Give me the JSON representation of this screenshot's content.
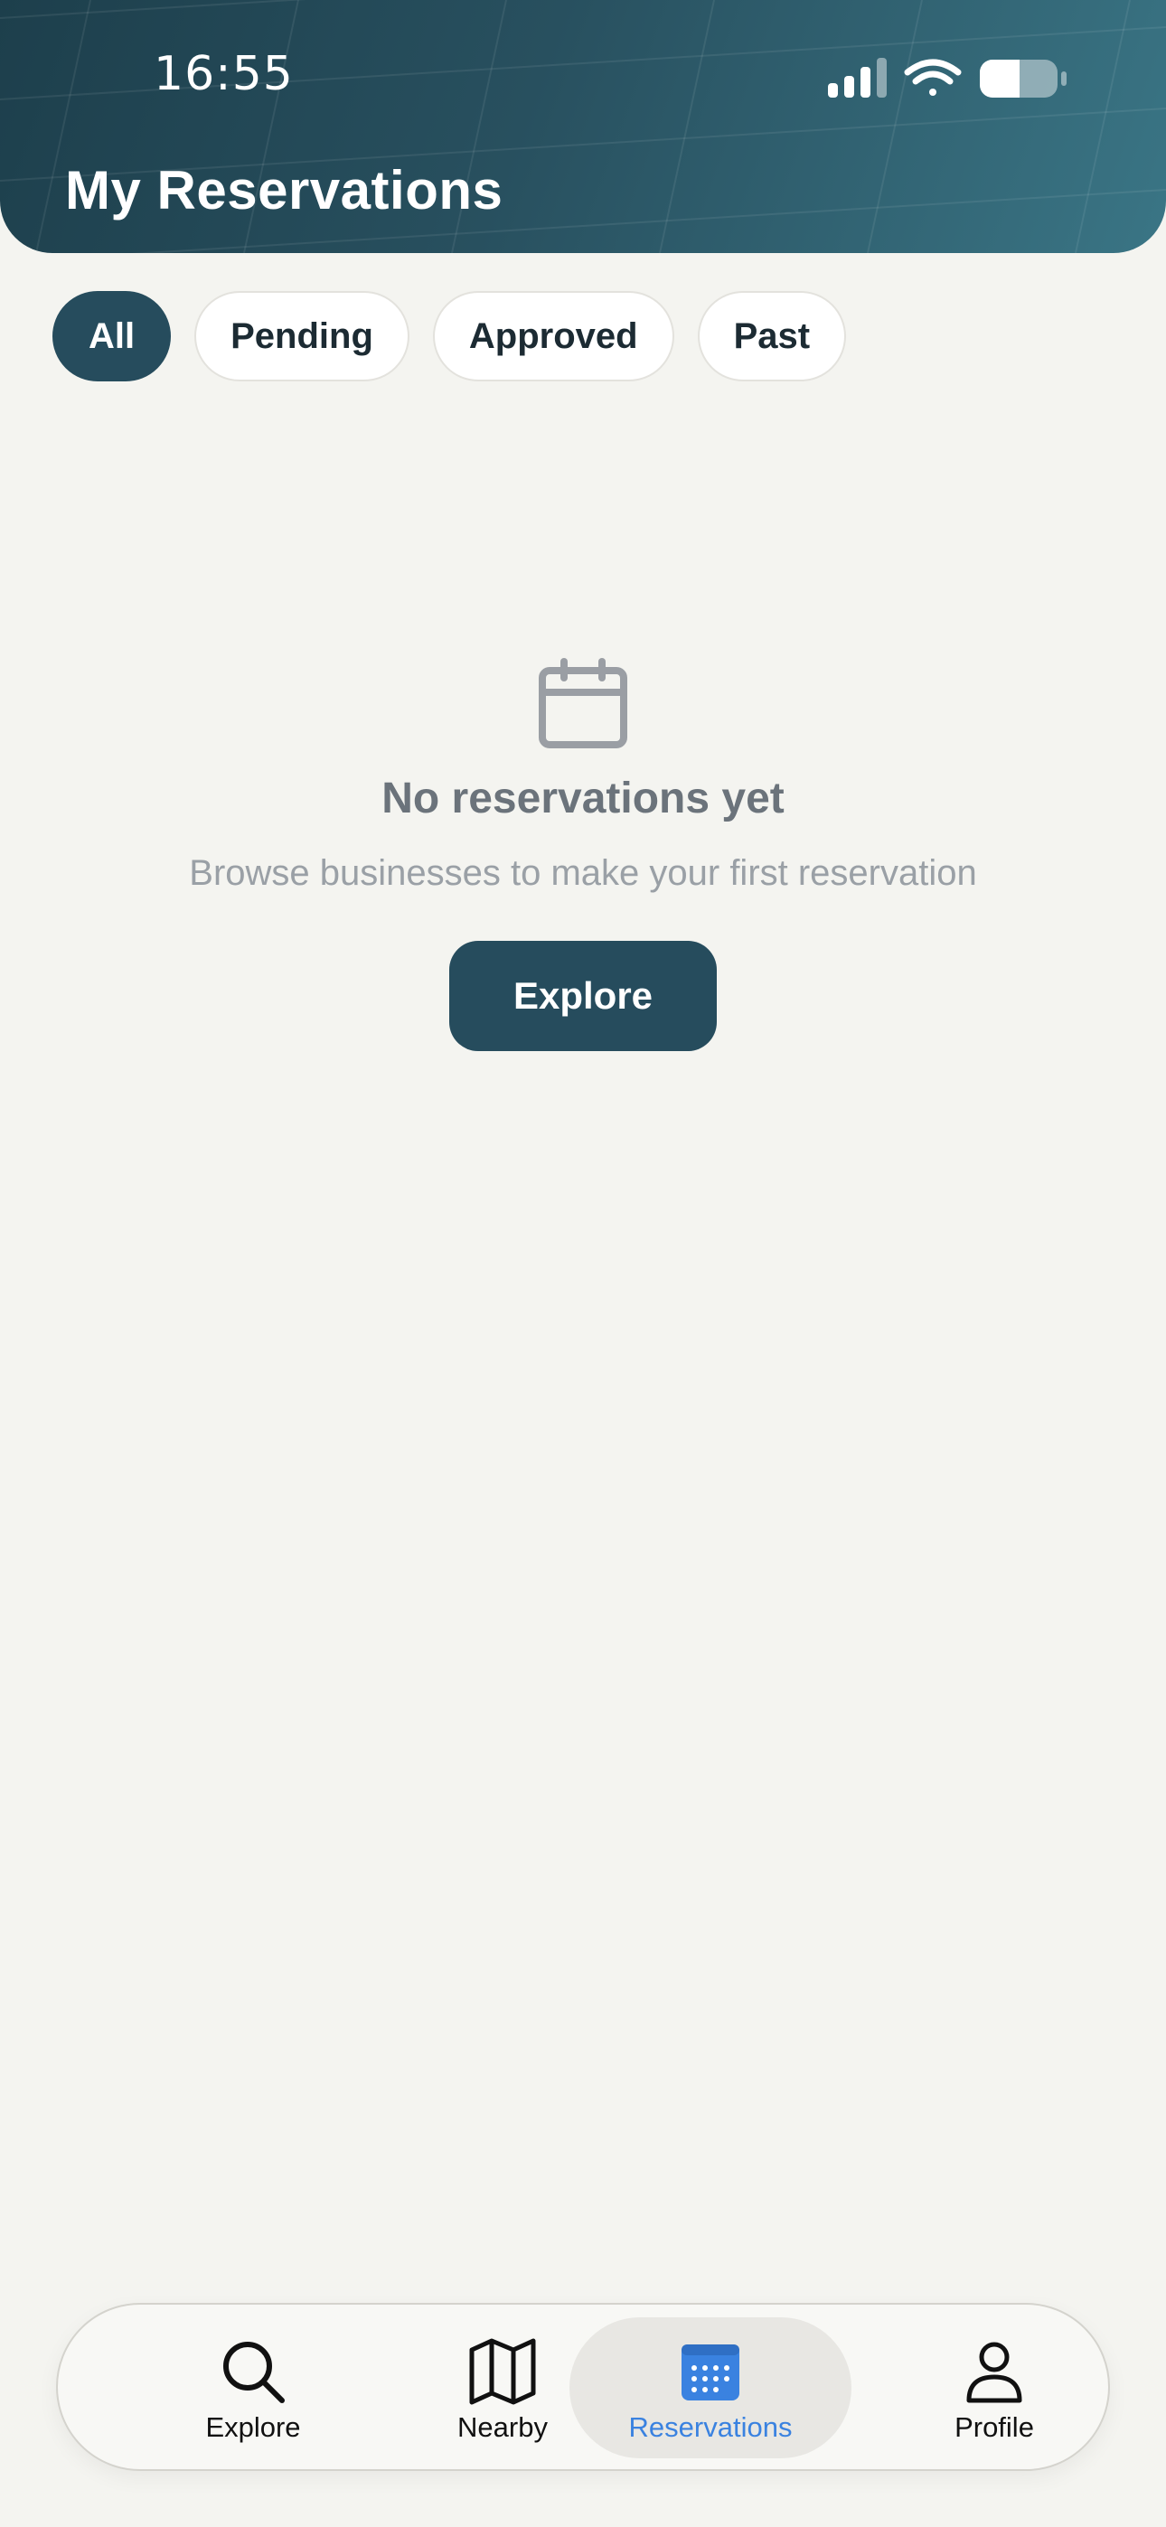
{
  "status_bar": {
    "time": "16:55",
    "icons": [
      "cellular-signal-icon",
      "wifi-icon",
      "battery-icon"
    ]
  },
  "header": {
    "title": "My Reservations"
  },
  "filters": {
    "selected": "All",
    "items": [
      {
        "label": "All"
      },
      {
        "label": "Pending"
      },
      {
        "label": "Approved"
      },
      {
        "label": "Past"
      }
    ]
  },
  "empty_state": {
    "icon": "calendar-icon",
    "title": "No reservations yet",
    "subtitle": "Browse businesses to make your first reservation",
    "button_label": "Explore"
  },
  "tabbar": {
    "active": "Reservations",
    "items": [
      {
        "label": "Explore",
        "icon": "search-icon"
      },
      {
        "label": "Nearby",
        "icon": "map-icon"
      },
      {
        "label": "Reservations",
        "icon": "calendar-icon"
      },
      {
        "label": "Profile",
        "icon": "person-icon"
      }
    ]
  },
  "colors": {
    "accent": "#264c5d",
    "active_tab": "#3a82e0",
    "background": "#f4f4f0"
  }
}
